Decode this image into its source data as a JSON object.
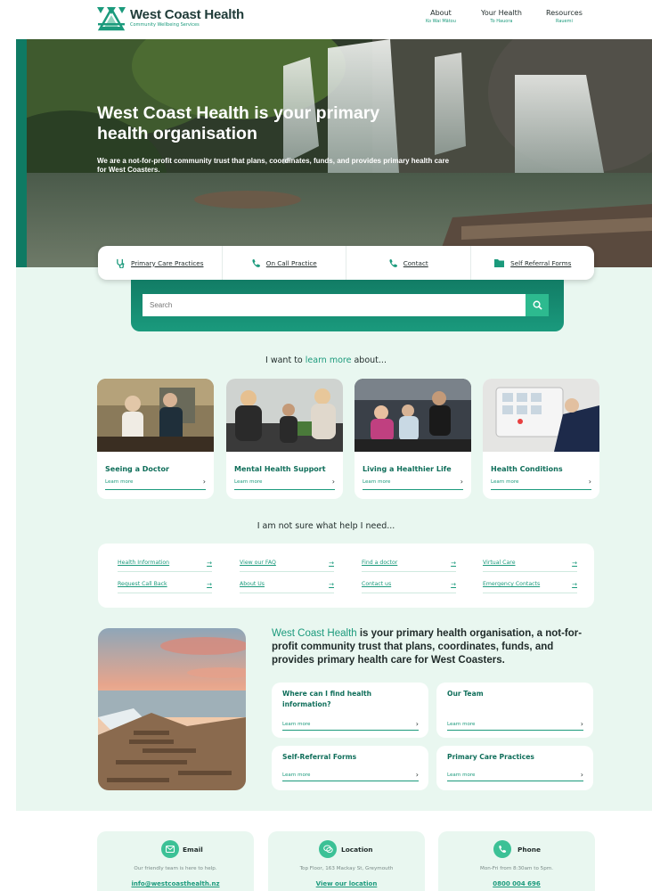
{
  "header": {
    "logo_title": "West Coast Health",
    "logo_subtitle": "Community Wellbeing Services",
    "nav": [
      {
        "label": "About",
        "sub": "Ko Wai Mātou"
      },
      {
        "label": "Your Health",
        "sub": "To Hauora"
      },
      {
        "label": "Resources",
        "sub": "Rauemi"
      }
    ]
  },
  "hero": {
    "title": "West Coast Health is your primary health organisation",
    "description": "We are a not-for-profit community trust that plans, coordinates, funds, and provides primary health care for West Coasters."
  },
  "quick_links": [
    {
      "label": "Primary Care Practices",
      "icon": "stethoscope-icon"
    },
    {
      "label": "On Call Practice",
      "icon": "phone-icon"
    },
    {
      "label": "Contact",
      "icon": "phone-icon"
    },
    {
      "label": "Self Referral Forms",
      "icon": "folder-icon"
    }
  ],
  "search": {
    "placeholder": "Search"
  },
  "learn": {
    "prefix": "I want to ",
    "accent": "learn more",
    "suffix": " about...",
    "cards": [
      {
        "title": "Seeing a Doctor",
        "link": "Learn more"
      },
      {
        "title": "Mental Health Support",
        "link": "Learn more"
      },
      {
        "title": "Living a Healthier Life",
        "link": "Learn more"
      },
      {
        "title": "Health Conditions",
        "link": "Learn more"
      }
    ]
  },
  "help": {
    "title": "I am not sure what help I need...",
    "links": [
      "Health Information",
      "View our FAQ",
      "Find a doctor",
      "Virtual Care",
      "Request Call Back",
      "About Us",
      "Contact us",
      "Emergency Contacts"
    ]
  },
  "about": {
    "accent": "West Coast Health",
    "text": " is your primary health organisation, a not-for-profit community trust that plans, coordinates, funds, and provides primary health care for West Coasters.",
    "cards": [
      {
        "title": "Where can I find health information?",
        "link": "Learn more"
      },
      {
        "title": "Our Team",
        "link": "Learn more"
      },
      {
        "title": "Self-Referral Forms",
        "link": "Learn more"
      },
      {
        "title": "Primary Care Practices",
        "link": "Learn more"
      }
    ]
  },
  "contact": [
    {
      "title": "Email",
      "desc": "Our friendly team is here to help.",
      "link": "info@westcoasthealth.nz",
      "icon": "email-icon"
    },
    {
      "title": "Location",
      "desc": "Top Floor, 163 Mackay St, Greymouth",
      "link": "View our location",
      "icon": "chat-icon"
    },
    {
      "title": "Phone",
      "desc": "Mon-Fri from 8:30am to 5pm.",
      "link": "0800 004 696",
      "icon": "phone-icon"
    }
  ],
  "colors": {
    "brand": "#1b9a7c",
    "brand_dark": "#0f6e5a",
    "mint": "#e9f7f0"
  }
}
